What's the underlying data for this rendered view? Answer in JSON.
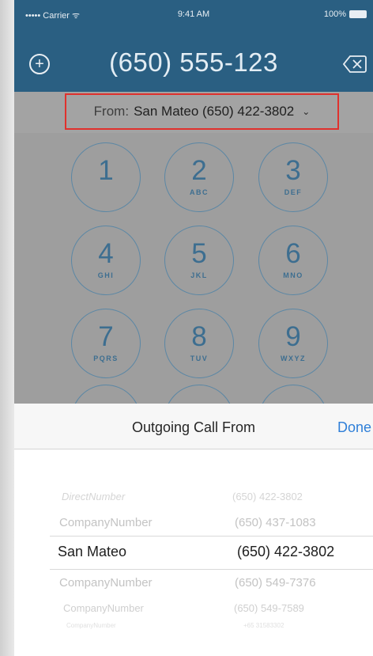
{
  "status_bar": {
    "carrier": "••••• Carrier ᯤ",
    "time": "9:41 AM",
    "battery": "100%"
  },
  "header": {
    "add_icon": "+",
    "dialed_number": "(650) 555-123"
  },
  "from_selector": {
    "label": "From:",
    "value": "San Mateo (650) 422-3802",
    "chevron": "⌄"
  },
  "keypad": [
    {
      "digit": "1",
      "letters": ""
    },
    {
      "digit": "2",
      "letters": "ABC"
    },
    {
      "digit": "3",
      "letters": "DEF"
    },
    {
      "digit": "4",
      "letters": "GHI"
    },
    {
      "digit": "5",
      "letters": "JKL"
    },
    {
      "digit": "6",
      "letters": "MNO"
    },
    {
      "digit": "7",
      "letters": "PQRS"
    },
    {
      "digit": "8",
      "letters": "TUV"
    },
    {
      "digit": "9",
      "letters": "WXYZ"
    }
  ],
  "sheet": {
    "title": "Outgoing Call From",
    "done_label": "Done",
    "options": [
      {
        "name": "DirectNumber",
        "number": "(650) 422-3802"
      },
      {
        "name": "CompanyNumber",
        "number": "(650) 437-1083"
      },
      {
        "name": "San Mateo",
        "number": "(650) 422-3802",
        "selected": true
      },
      {
        "name": "CompanyNumber",
        "number": "(650) 549-7376"
      },
      {
        "name": "CompanyNumber",
        "number": "(650) 549-7589"
      },
      {
        "name": "CompanyNumber",
        "number": "+65 31583302"
      }
    ]
  }
}
